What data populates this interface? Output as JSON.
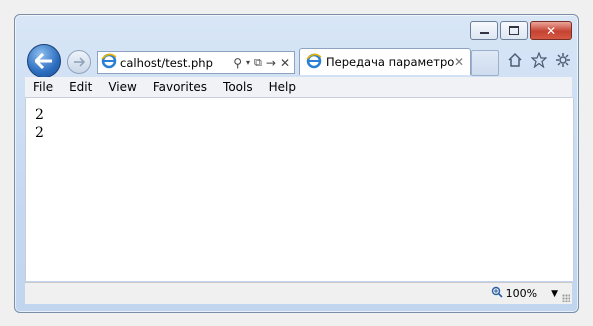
{
  "browser": {
    "address_url": "calhost/test.php",
    "tab_title": "Передача параметро...",
    "icons": [
      "back-arrow-icon",
      "forward-arrow-icon",
      "ie-logo-icon",
      "search-icon",
      "dropdown-icon",
      "compatibility-icon",
      "go-icon",
      "stop-icon",
      "tab-close-icon",
      "home-icon",
      "favorites-star-icon",
      "gear-icon"
    ]
  },
  "menu": [
    "File",
    "Edit",
    "View",
    "Favorites",
    "Tools",
    "Help"
  ],
  "content": {
    "lines": [
      "2",
      "2"
    ]
  },
  "status": {
    "zoom": "100%"
  }
}
